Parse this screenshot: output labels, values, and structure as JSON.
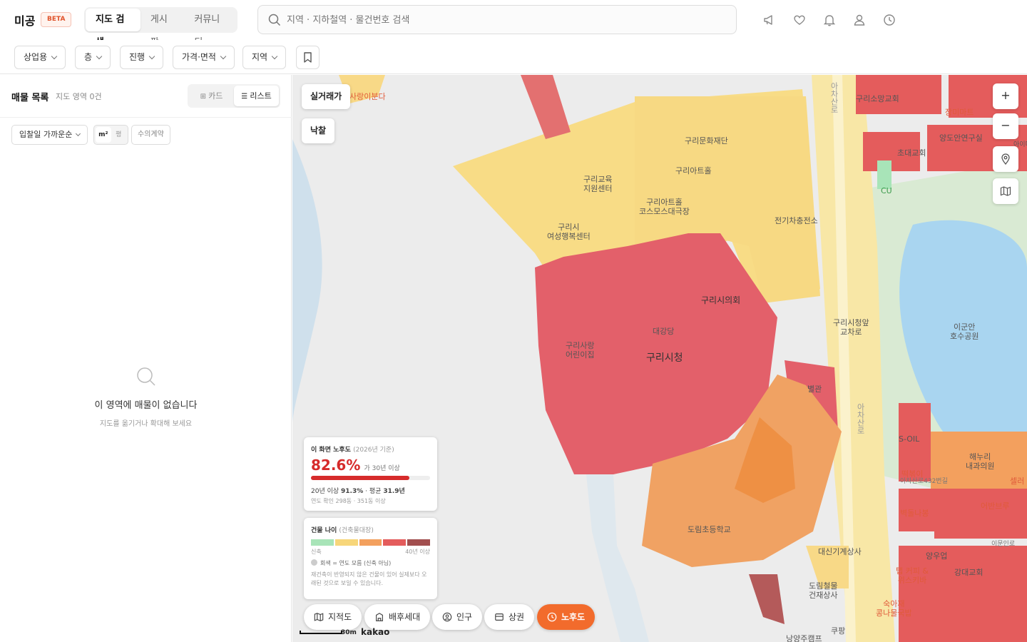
{
  "header": {
    "logo": "미공",
    "badge": "BETA",
    "tabs": [
      {
        "label": "지도 검색",
        "active": true
      },
      {
        "label": "게시판",
        "active": false
      },
      {
        "label": "커뮤니티",
        "active": false
      }
    ],
    "search_placeholder": "지역 · 지하철역 · 물건번호 검색",
    "icons": [
      "megaphone-icon",
      "heart-icon",
      "bell-icon",
      "user-icon",
      "clock-icon"
    ]
  },
  "filters": {
    "items": [
      "상업용",
      "층",
      "진행",
      "가격·면적",
      "지역"
    ],
    "bookmark_icon": "bookmark-icon"
  },
  "left": {
    "title": "매물 목록",
    "subtitle": "지도 영역 0건",
    "view_toggle": [
      {
        "label": "카드",
        "active": false
      },
      {
        "label": "리스트",
        "active": true
      }
    ],
    "sort": "입찰일 가까운순",
    "unit_m2": "m²",
    "unit_pyeong": "평",
    "contract": "수의계약",
    "empty_title": "이 영역에 매물이 없습니다",
    "empty_sub": "지도를 옮기거나 확대해 보세요"
  },
  "map": {
    "toggles": [
      "실거래가",
      "낙찰"
    ],
    "zoom_in": "+",
    "zoom_out": "−",
    "labels": {
      "l1": "구리문화재단",
      "l2": "구리아트홀",
      "l3": "구리교육\n지원센터",
      "l4": "구리아트홀\n코스모스대극장",
      "l5": "구리시\n여성행복센터",
      "l6": "전기차충전소",
      "l7": "구리시의회",
      "l8": "대강당",
      "l9": "구리시청",
      "l10": "구리사랑\n어린이집",
      "l11": "별관",
      "l12": "도림초등학교",
      "l13": "구리시청앞\n교차로",
      "l14": "이군안\n호수공원",
      "l15": "구리소망교회",
      "l16": "장미마트",
      "l17": "양도안연구실",
      "l18": "초대교회",
      "l19": "CU",
      "l20": "S-OIL",
      "l21": "해누리\n내과의원",
      "l22": "대신기계상사",
      "l23": "도림철물\n건재상사",
      "l24": "양우업",
      "l25": "강대교회",
      "l26": "어반브루",
      "l27": "아차산로",
      "l28": "아차산로",
      "l29": "사랑이분다",
      "l30": "쿠팡",
      "l31": "숙아재\n콩나물국밥",
      "l32": "아차산로432번길",
      "l33": "탭 커피 &\n위스키바",
      "l34": "떡볶이",
      "l35": "벽돌나봉",
      "l36": "아이디",
      "l37": "셀러",
      "l38": "낭양주캠프",
      "l39": "이문인로"
    },
    "scale": "30m",
    "kakao": "kakao",
    "age_card": {
      "caption": "이 화면 노후도",
      "caption_note": "(2026년 기준)",
      "percent": "82.6%",
      "percent_note": "가 30년 이상",
      "ratio": 0.826,
      "line1_prefix": "20년 이상",
      "line1_pct": "91.3%",
      "line1_mid": "· 평균",
      "line1_avg": "31.9년",
      "line2": "연도 확인 298동 · 351동 이상"
    },
    "legend_card": {
      "caption": "건물 나이",
      "caption_note": "(건축물대장)",
      "colors": [
        "#a8e4b8",
        "#f7d67a",
        "#f3a05e",
        "#e45c5c",
        "#a24f4f"
      ],
      "left_label": "신축",
      "right_label": "40년 이상",
      "gray_note": "회색 = 연도 모름 (신축 아님)",
      "footnote": "재건축이 반영되지 않은 건물이 있어 실제보다 오래된 것으로 보일 수 있습니다."
    },
    "bottom_buttons": [
      {
        "label": "지적도",
        "icon": "map-icon",
        "active": false
      },
      {
        "label": "배후세대",
        "icon": "building-icon",
        "active": false
      },
      {
        "label": "인구",
        "icon": "person-icon",
        "active": false
      },
      {
        "label": "상권",
        "icon": "store-icon",
        "active": false
      },
      {
        "label": "노후도",
        "icon": "clock-icon",
        "active": true
      }
    ]
  }
}
